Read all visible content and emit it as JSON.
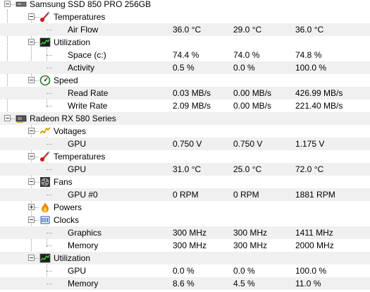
{
  "tree": {
    "ssd": {
      "name": "Samsung SSD 850 PRO 256GB",
      "icon": "drive-icon",
      "temperatures": {
        "label": "Temperatures",
        "icon": "thermometer-icon",
        "rows": [
          {
            "name": "Air Flow",
            "value": "36.0 °C",
            "min": "29.0 °C",
            "max": "36.0 °C"
          }
        ]
      },
      "utilization": {
        "label": "Utilization",
        "icon": "load-monitor-icon",
        "rows": [
          {
            "name": "Space (c:)",
            "value": "74.4 %",
            "min": "74.0 %",
            "max": "74.8 %"
          },
          {
            "name": "Activity",
            "value": "0.5 %",
            "min": "0.0 %",
            "max": "100.0 %"
          }
        ]
      },
      "speed": {
        "label": "Speed",
        "icon": "speedometer-icon",
        "rows": [
          {
            "name": "Read Rate",
            "value": "0.03 MB/s",
            "min": "0.00 MB/s",
            "max": "426.99 MB/s"
          },
          {
            "name": "Write Rate",
            "value": "2.09 MB/s",
            "min": "0.00 MB/s",
            "max": "221.40 MB/s"
          }
        ]
      }
    },
    "gpu": {
      "name": "Radeon RX 580 Series",
      "icon": "graphics-card-icon",
      "voltages": {
        "label": "Voltages",
        "icon": "voltage-icon",
        "rows": [
          {
            "name": "GPU",
            "value": "0.750 V",
            "min": "0.750 V",
            "max": "1.175 V"
          }
        ]
      },
      "temperatures": {
        "label": "Temperatures",
        "icon": "thermometer-icon",
        "rows": [
          {
            "name": "GPU",
            "value": "31.0 °C",
            "min": "25.0 °C",
            "max": "72.0 °C"
          }
        ]
      },
      "fans": {
        "label": "Fans",
        "icon": "fan-icon",
        "rows": [
          {
            "name": "GPU #0",
            "value": "0 RPM",
            "min": "0 RPM",
            "max": "1881 RPM"
          }
        ]
      },
      "powers": {
        "label": "Powers",
        "icon": "power-flame-icon",
        "collapsed": true
      },
      "clocks": {
        "label": "Clocks",
        "icon": "clock-chip-icon",
        "rows": [
          {
            "name": "Graphics",
            "value": "300 MHz",
            "min": "300 MHz",
            "max": "1411 MHz"
          },
          {
            "name": "Memory",
            "value": "300 MHz",
            "min": "300 MHz",
            "max": "2000 MHz"
          }
        ]
      },
      "utilization": {
        "label": "Utilization",
        "icon": "load-monitor-icon",
        "rows": [
          {
            "name": "GPU",
            "value": "0.0 %",
            "min": "0.0 %",
            "max": "100.0 %"
          },
          {
            "name": "Memory",
            "value": "8.6 %",
            "min": "4.5 %",
            "max": "11.0 %"
          }
        ]
      }
    }
  },
  "colors": {
    "alt_row": "#f0f0f0",
    "tree_line": "#9a9a9a"
  }
}
